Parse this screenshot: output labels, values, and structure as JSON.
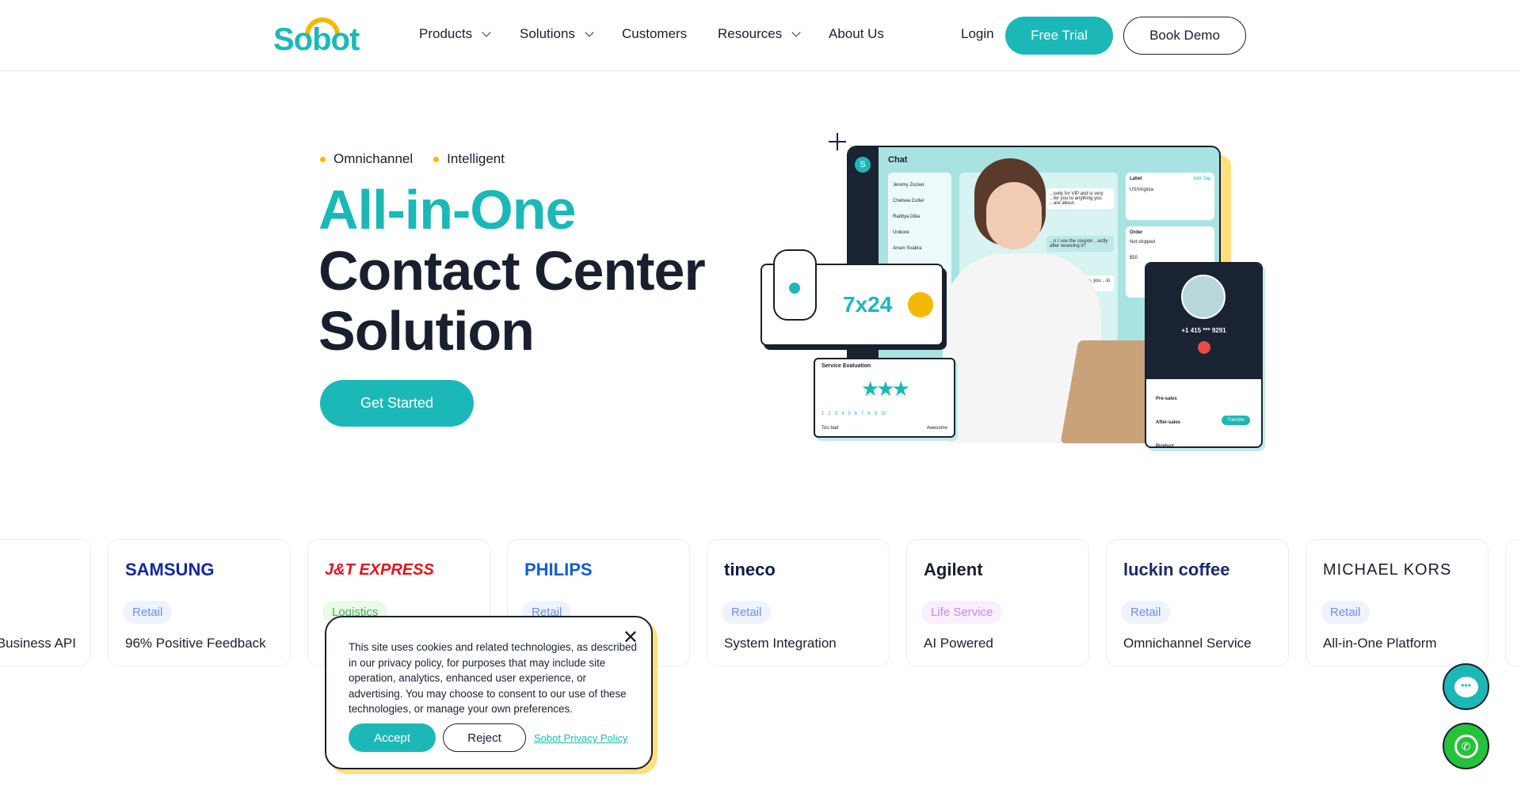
{
  "brand": {
    "logo_text": "Sobot"
  },
  "nav": {
    "items": [
      {
        "label": "Products",
        "dropdown": true
      },
      {
        "label": "Solutions",
        "dropdown": true
      },
      {
        "label": "Customers",
        "dropdown": false
      },
      {
        "label": "Resources",
        "dropdown": true
      },
      {
        "label": "About Us",
        "dropdown": false
      }
    ],
    "login": "Login",
    "free_trial": "Free Trial",
    "book_demo": "Book Demo"
  },
  "hero": {
    "tags": [
      "Omnichannel",
      "Intelligent"
    ],
    "title_line1": "All-in-One",
    "title_line2": "Contact Center",
    "title_line3": "Solution",
    "cta": "Get Started",
    "illustration": {
      "chat_title": "Chat",
      "contacts": [
        "Jeremy Zucker",
        "Chelsea Cutler",
        "Raditya Dika",
        "Unikore",
        "Arsen Svabra"
      ],
      "messages": [
        "...ively for VIP and is very ...fer you to anything you ...are about.",
        "...n I use the coupon ...ectly after receiving it?",
        "...is very easy to do, you ...to get it"
      ],
      "label_panel": "Label",
      "add_tag": "Add Tag",
      "customer": "US/Virginia",
      "order_panel": "Order",
      "order_status": "Not shipped",
      "order_price": "$50",
      "badge": "7x24",
      "evaluation_title": "Service Evaluation",
      "scale": [
        "1",
        "2",
        "3",
        "4",
        "5",
        "6",
        "7",
        "8",
        "9",
        "10"
      ],
      "scale_low": "Too bad",
      "scale_high": "Awesome",
      "phone_number": "+1 415 *** 9291",
      "queues": [
        "Pre-sales",
        "After-sales",
        "Product"
      ],
      "transfer": "Transfer"
    }
  },
  "customers": [
    {
      "logo": "",
      "tag": "",
      "label": "Business API"
    },
    {
      "logo": "SAMSUNG",
      "logo_color": "#1428a0",
      "tag": "Retail",
      "tag_type": "retail",
      "label": "96% Positive Feedback"
    },
    {
      "logo": "J&T EXPRESS",
      "logo_color": "#e0141e",
      "tag": "Logistics",
      "tag_type": "logistics",
      "label": ""
    },
    {
      "logo": "PHILIPS",
      "logo_color": "#0b5ed7",
      "tag": "Retail",
      "tag_type": "retail",
      "label": ""
    },
    {
      "logo": "tineco",
      "logo_color": "#0d1a4a",
      "tag": "Retail",
      "tag_type": "retail",
      "label": "System Integration"
    },
    {
      "logo": "Agilent",
      "logo_color": "#1a1f2e",
      "tag": "Life Service",
      "tag_type": "life",
      "label": "AI Powered"
    },
    {
      "logo": "luckin coffee",
      "logo_color": "#1a2a6c",
      "tag": "Retail",
      "tag_type": "retail",
      "label": "Omnichannel Service"
    },
    {
      "logo": "MICHAEL KORS",
      "logo_color": "#1a1f2e",
      "tag": "Retail",
      "tag_type": "retail",
      "label": "All-in-One Platform"
    },
    {
      "logo": "",
      "tag": "",
      "label": ""
    }
  ],
  "cookie": {
    "text": "This site uses cookies and related technologies, as described in our privacy policy, for purposes that may include site operation, analytics, enhanced user experience, or advertising. You may choose to consent to our use of these technologies, or manage your own preferences.",
    "accept": "Accept",
    "reject": "Reject",
    "policy_link": "Sobot Privacy Policy"
  },
  "floating": {
    "chat": "chat-bubble-icon",
    "whatsapp": "whatsapp-icon"
  },
  "colors": {
    "accent": "#1cb8b8",
    "yellow": "#f5b800",
    "dark": "#1a1f2e",
    "retail": "#6b8ff0",
    "logistics": "#4caf50",
    "life": "#c58af0"
  }
}
